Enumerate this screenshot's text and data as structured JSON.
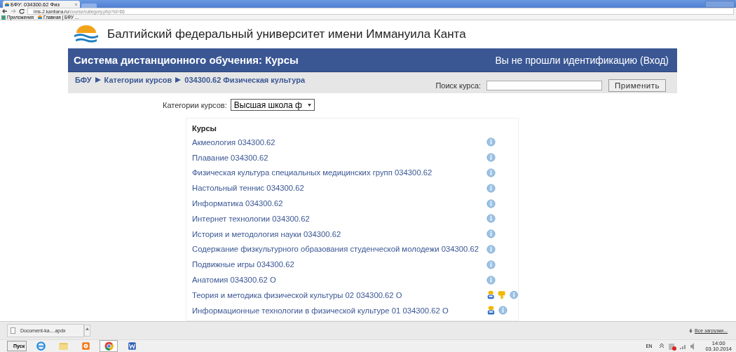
{
  "browser": {
    "tab_title": "БФУ: 034300.62 Физ",
    "address": {
      "host": "lms-2.kantiana.ru",
      "path": "/course/category.php?id=66"
    },
    "bookmarks": [
      "Приложения",
      "Главная | БФУ ..."
    ]
  },
  "site": {
    "title": "Балтийский федеральный университет имени Иммануила Канта"
  },
  "header": {
    "title": "Система дистанционного обучения: Курсы",
    "login_text": "Вы не прошли идентификацию (",
    "login_link": "Вход",
    "login_end": ")"
  },
  "breadcrumb": [
    "БФУ",
    "Категории курсов",
    "034300.62 Физическая культура"
  ],
  "search": {
    "label": "Поиск курса:",
    "button": "Применить"
  },
  "category": {
    "label": "Категории курсов:",
    "value": "Высшая школа ф"
  },
  "courses": {
    "heading": "Курсы",
    "rows": [
      {
        "name": "Акмеология 034300.62",
        "icons": [
          {
            "kind": "info"
          }
        ]
      },
      {
        "name": "Плавание 034300.62",
        "icons": [
          {
            "kind": "info"
          }
        ]
      },
      {
        "name": "Физическая культура специальных медицинских групп 034300.62",
        "icons": [
          {
            "kind": "info"
          }
        ]
      },
      {
        "name": "Настольный теннис 034300.62",
        "icons": [
          {
            "kind": "info"
          }
        ]
      },
      {
        "name": "Информатика 034300.62",
        "icons": [
          {
            "kind": "info"
          }
        ]
      },
      {
        "name": "Интернет технологии 034300.62",
        "icons": [
          {
            "kind": "info"
          }
        ]
      },
      {
        "name": "История и методология науки 034300.62",
        "icons": [
          {
            "kind": "info"
          }
        ]
      },
      {
        "name": "Содержание физкультурного образования студенческой молодежи 034300.62",
        "icons": [
          {
            "kind": "info"
          }
        ]
      },
      {
        "name": "Подвижные игры 034300.62",
        "icons": [
          {
            "kind": "info"
          }
        ]
      },
      {
        "name": "Анатомия 034300.62 О",
        "icons": [
          {
            "kind": "info"
          }
        ]
      },
      {
        "name": "Теория и методика физической культуры 02 034300.62 О",
        "icons": [
          {
            "kind": "person"
          },
          {
            "kind": "key"
          },
          {
            "kind": "info"
          }
        ]
      },
      {
        "name": "Информационные технологии в физической культуре 01 034300.62 О",
        "icons": [
          {
            "kind": "person"
          },
          {
            "kind": "info"
          }
        ]
      }
    ]
  },
  "downloads": {
    "file": "Document-ka....apdx",
    "all": "Все загрузки..."
  },
  "taskbar": {
    "start": "Пуск",
    "lang": "EN",
    "time": "14:00",
    "date": "03.10.2014"
  }
}
